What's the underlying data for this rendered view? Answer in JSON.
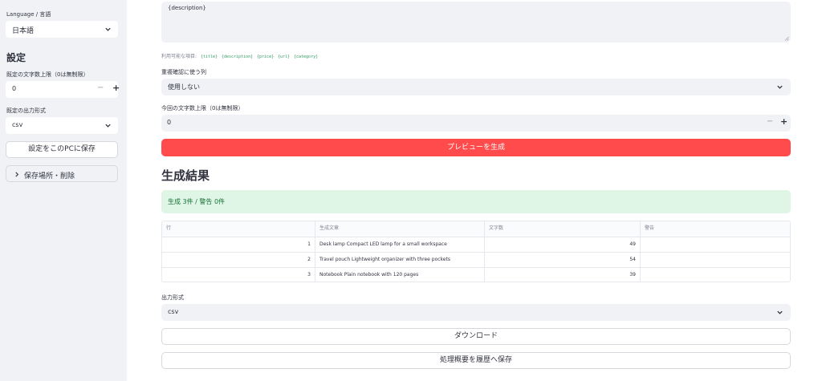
{
  "sidebar": {
    "language_label": "Language / 言語",
    "language_value": "日本語",
    "settings_heading": "設定",
    "default_limit_label": "既定の文字数上限（0は無制限）",
    "default_limit_value": "0",
    "default_format_label": "既定の出力形式",
    "default_format_value": "csv",
    "save_button": "設定をこのPCに保存",
    "storage_expander": "保存場所・削除"
  },
  "main": {
    "template_value": "{description}",
    "fields_label": "利用可能な項目:",
    "fields": [
      "{title}",
      "{description}",
      "{price}",
      "{url}",
      "{category}"
    ],
    "dedupe_label": "重複確認に使う列",
    "dedupe_value": "使用しない",
    "limit_label": "今回の文字数上限（0は無制限）",
    "limit_value": "0",
    "preview_button": "プレビューを生成",
    "results_heading": "生成結果",
    "status_message": "生成 3件 / 警告 0件",
    "table": {
      "headers": [
        "行",
        "生成文章",
        "文字数",
        "警告"
      ],
      "rows": [
        {
          "row": "1",
          "text": "Desk lamp  Compact LED lamp for a small workspace",
          "chars": "49",
          "warning": ""
        },
        {
          "row": "2",
          "text": "Travel pouch  Lightweight organizer with three pockets",
          "chars": "54",
          "warning": ""
        },
        {
          "row": "3",
          "text": "Notebook  Plain notebook with 120 pages",
          "chars": "39",
          "warning": ""
        }
      ]
    },
    "output_format_label": "出力形式",
    "output_format_value": "csv",
    "download_button": "ダウンロード",
    "save_history_button": "処理概要を履歴へ保存"
  },
  "colors": {
    "primary": "#ff4b4b",
    "sidebar_bg": "#f0f2f6",
    "success_bg": "#dff5e6",
    "success_text": "#177233",
    "code_text": "#2f9e61"
  },
  "icons": {
    "select": "chevron-down-icon",
    "expander": "chevron-right-icon",
    "resize": "resize-grip-icon"
  }
}
